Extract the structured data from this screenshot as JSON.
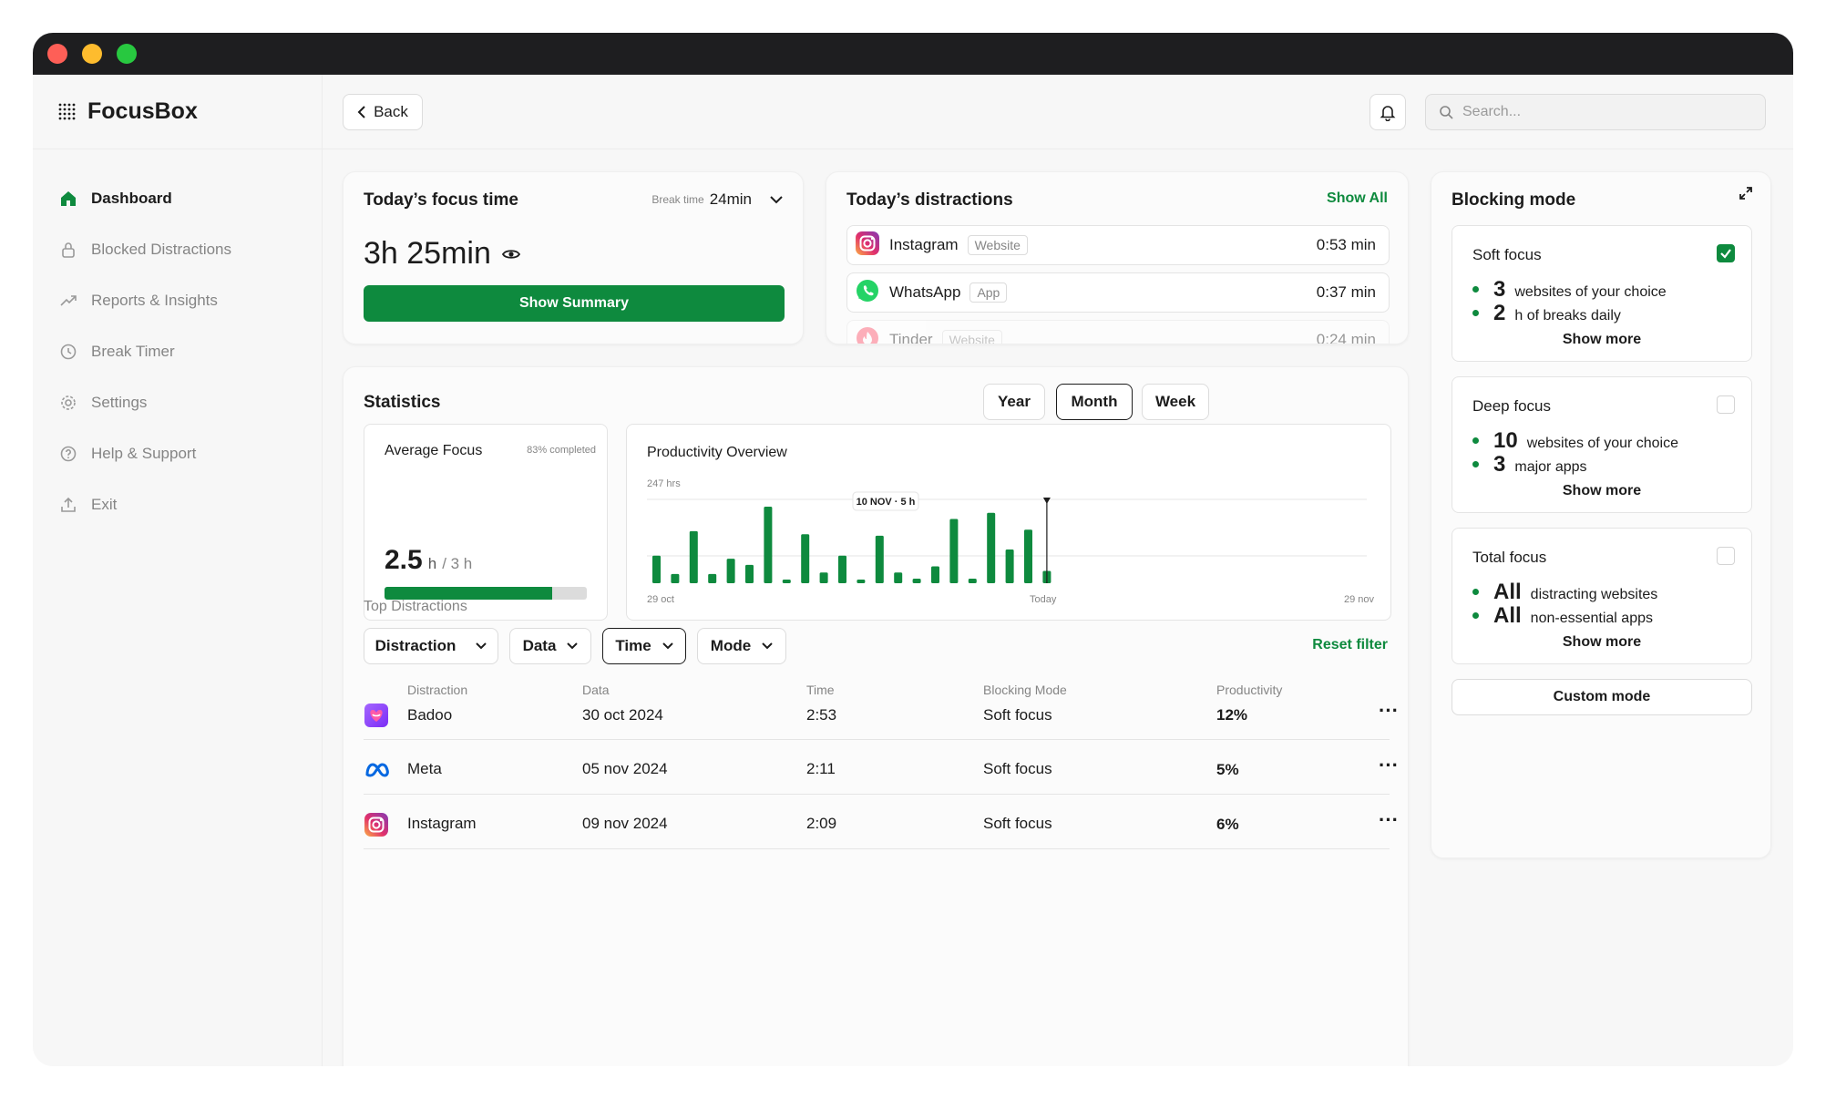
{
  "window": {
    "dot_colors": [
      "#fe5f57",
      "#febc2e",
      "#28c840"
    ]
  },
  "brand": {
    "name": "FocusBox"
  },
  "sidebar": {
    "items": [
      {
        "label": "Dashboard",
        "icon": "home-icon"
      },
      {
        "label": "Blocked Distractions",
        "icon": "lock-icon"
      },
      {
        "label": "Reports & Insights",
        "icon": "trend-icon"
      },
      {
        "label": "Break Timer",
        "icon": "clock-icon"
      },
      {
        "label": "Settings",
        "icon": "gear-icon"
      },
      {
        "label": "Help & Support",
        "icon": "help-icon"
      },
      {
        "label": "Exit",
        "icon": "exit-icon"
      }
    ]
  },
  "topbar": {
    "back_label": "Back",
    "search_placeholder": "Search..."
  },
  "focus": {
    "title": "Today’s focus time",
    "break_label": "Break time",
    "break_value": "24min",
    "value": "3h 25min",
    "button": "Show Summary"
  },
  "distractions": {
    "title": "Today’s distractions",
    "show_all": "Show All",
    "items": [
      {
        "name": "Instagram",
        "type": "Website",
        "time": "0:53 min"
      },
      {
        "name": "WhatsApp",
        "type": "App",
        "time": "0:37 min"
      },
      {
        "name": "Tinder",
        "type": "Website",
        "time": "0:24 min"
      }
    ]
  },
  "stats": {
    "title": "Statistics",
    "periods": [
      "Year",
      "Month",
      "Week"
    ],
    "selected_period": "Month",
    "avg": {
      "title": "Average Focus",
      "completed": "83% completed",
      "value": "2.5",
      "unit": "h",
      "target": "/ 3 h",
      "progress": 0.83
    },
    "overview": {
      "title": "Productivity Overview",
      "ylabel": "247 hrs",
      "tooltip": "10 NOV · 5 h",
      "x_start": "29 oct",
      "x_mid": "Today",
      "x_end": "29 nov"
    },
    "top_title": "Top Distractions",
    "filters": [
      "Distraction",
      "Data",
      "Time",
      "Mode"
    ],
    "reset": "Reset filter",
    "columns": [
      "Distraction",
      "Data",
      "Time",
      "Blocking Mode",
      "Productivity"
    ],
    "rows": [
      {
        "name": "Badoo",
        "date": "30 oct 2024",
        "time": "2:53",
        "mode": "Soft focus",
        "prod": "12%"
      },
      {
        "name": "Meta",
        "date": "05 nov 2024",
        "time": "2:11",
        "mode": "Soft focus",
        "prod": "5%"
      },
      {
        "name": "Instagram",
        "date": "09 nov 2024",
        "time": "2:09",
        "mode": "Soft focus",
        "prod": "6%"
      }
    ]
  },
  "chart_data": {
    "type": "bar",
    "title": "Productivity Overview",
    "ylabel": "247 hrs",
    "x_labels": [
      "29 oct",
      "Today",
      "29 nov"
    ],
    "annotation": "10 NOV · 5 h",
    "values": [
      1.8,
      0.6,
      3.4,
      0.6,
      1.6,
      1.2,
      5.0,
      0.2,
      3.2,
      0.7,
      1.8,
      0.2,
      3.1,
      0.7,
      0.3,
      1.1,
      4.2,
      0.3,
      4.6,
      2.2,
      3.5,
      0.8
    ],
    "highlight_index": 21,
    "grid": true
  },
  "blocking": {
    "title": "Blocking mode",
    "modes": [
      {
        "title": "Soft focus",
        "checked": true,
        "lines": [
          {
            "big": "3",
            "text": "websites of your choice"
          },
          {
            "big": "2",
            "text": "h of breaks daily"
          }
        ],
        "more": "Show more"
      },
      {
        "title": "Deep focus",
        "checked": false,
        "lines": [
          {
            "big": "10",
            "text": "websites of your choice"
          },
          {
            "big": "3",
            "text": "major apps"
          }
        ],
        "more": "Show more"
      },
      {
        "title": "Total focus",
        "checked": false,
        "lines": [
          {
            "big": "All",
            "text": "distracting websites"
          },
          {
            "big": "All",
            "text": "non-essential apps"
          }
        ],
        "more": "Show more"
      }
    ],
    "custom": "Custom mode"
  }
}
